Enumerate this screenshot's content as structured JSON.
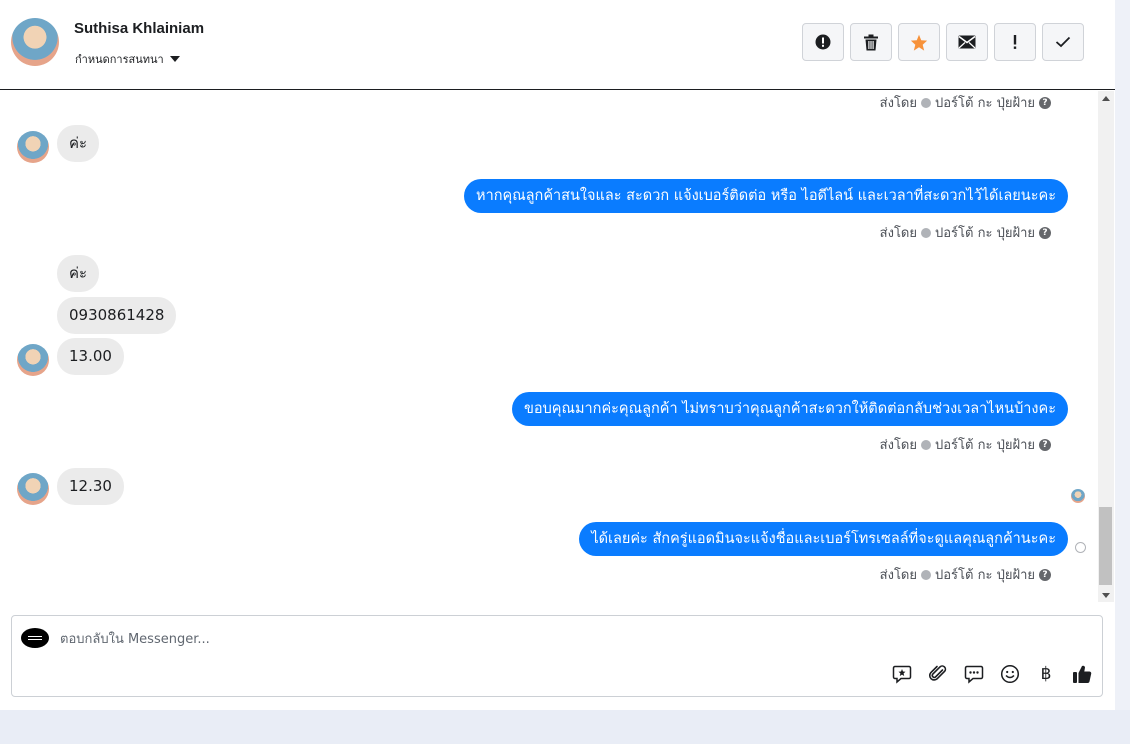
{
  "header": {
    "name": "Suthisa Khlainiam",
    "assign_label": "กำหนดการสนทนา",
    "actions": [
      {
        "name": "spam-button",
        "icon": "alert-circle-icon"
      },
      {
        "name": "delete-button",
        "icon": "trash-icon"
      },
      {
        "name": "star-button",
        "icon": "star-icon"
      },
      {
        "name": "mark-unread-button",
        "icon": "envelope-icon"
      },
      {
        "name": "important-button",
        "icon": "exclamation-icon"
      },
      {
        "name": "done-button",
        "icon": "checkmark-icon"
      }
    ]
  },
  "colors": {
    "outgoing_bubble": "#0a7cff",
    "incoming_bubble": "#ebebeb",
    "star": "#f7923a"
  },
  "sent_by": {
    "prefix": "ส่งโดย",
    "agent": "ปอร์โต้ กะ ปุ่ยฝ้าย",
    "help": "?"
  },
  "messages": {
    "in1": "ค่ะ",
    "out1": "หากคุณลูกค้าสนใจและ สะดวก แจ้งเบอร์ติดต่อ หรือ ไอดีไลน์ และเวลาที่สะดวกไว้ได้เลยนะคะ",
    "in2": "ค่ะ",
    "in3": "0930861428",
    "in4": "13.00",
    "out2": "ขอบคุณมากค่ะคุณลูกค้า ไม่ทราบว่าคุณลูกค้าสะดวกให้ติดต่อกลับช่วงเวลาไหนบ้างคะ",
    "in5": "12.30",
    "out3": "ได้เลยค่ะ สักครู่แอดมินจะแจ้งชื่อและเบอร์โทรเซลล์ที่จะดูแลคุณลูกค้านะคะ"
  },
  "reply": {
    "placeholder": "ตอบกลับใน Messenger...",
    "tools": [
      "sticker-icon",
      "paperclip-icon",
      "saved-replies-icon",
      "emoji-icon",
      "payment-icon",
      "like-icon"
    ],
    "baht_symbol": "฿"
  }
}
